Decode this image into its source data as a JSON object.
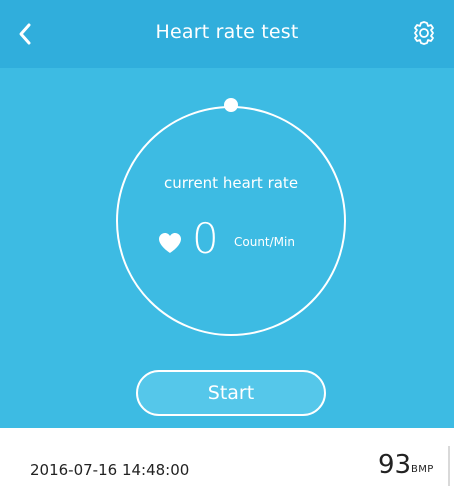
{
  "header": {
    "title": "Heart rate test",
    "back_icon": "chevron-left-icon",
    "settings_icon": "gear-icon"
  },
  "monitor": {
    "label": "current heart rate",
    "value": "0",
    "unit": "Count/Min",
    "heart_icon": "heart-icon",
    "start_label": "Start"
  },
  "history": [
    {
      "time": "2016-07-16 14:48:00",
      "value": "93",
      "unit": "BMP"
    }
  ],
  "colors": {
    "header_bg": "#30aedc",
    "main_bg": "#3dbbe3",
    "accent": "#ffffff"
  }
}
